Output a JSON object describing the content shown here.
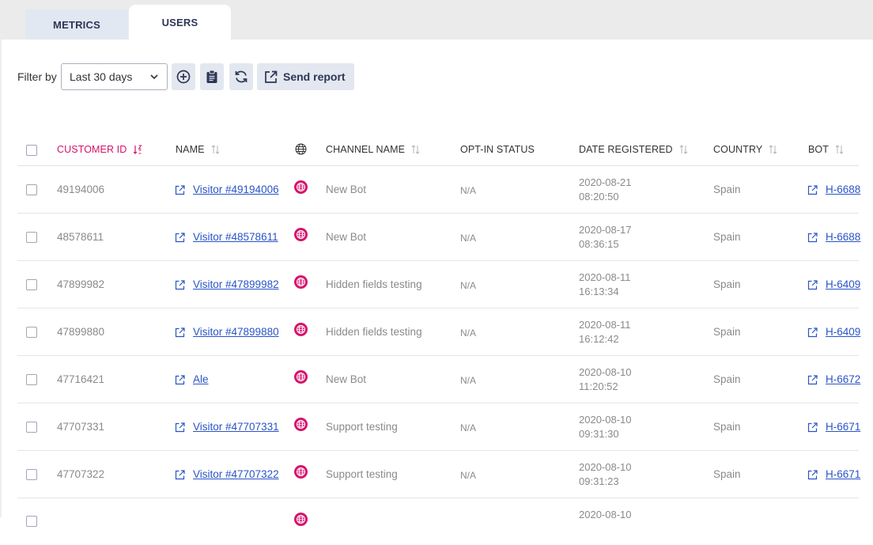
{
  "tabs": [
    {
      "label": "METRICS",
      "active": false
    },
    {
      "label": "USERS",
      "active": true
    }
  ],
  "toolbar": {
    "filter_label": "Filter by",
    "filter_value": "Last 30 days",
    "send_report_label": "Send report"
  },
  "table": {
    "headers": {
      "customer_id": "CUSTOMER ID",
      "name": "NAME",
      "channel_name": "CHANNEL NAME",
      "optin_status": "OPT-IN STATUS",
      "date_registered": "DATE REGISTERED",
      "country": "COUNTRY",
      "bot": "BOT"
    },
    "rows": [
      {
        "customer_id": "49194006",
        "name": "Visitor #49194006",
        "channel": "New Bot",
        "optin": "N/A",
        "date": "2020-08-21",
        "time": "08:20:50",
        "country": "Spain",
        "bot": "H-6688"
      },
      {
        "customer_id": "48578611",
        "name": "Visitor #48578611",
        "channel": "New Bot",
        "optin": "N/A",
        "date": "2020-08-17",
        "time": "08:36:15",
        "country": "Spain",
        "bot": "H-6688"
      },
      {
        "customer_id": "47899982",
        "name": "Visitor #47899982",
        "channel": "Hidden fields testing",
        "optin": "N/A",
        "date": "2020-08-11",
        "time": "16:13:34",
        "country": "Spain",
        "bot": "H-6409"
      },
      {
        "customer_id": "47899880",
        "name": "Visitor #47899880",
        "channel": "Hidden fields testing",
        "optin": "N/A",
        "date": "2020-08-11",
        "time": "16:12:42",
        "country": "Spain",
        "bot": "H-6409"
      },
      {
        "customer_id": "47716421",
        "name": "Ale",
        "channel": "New Bot",
        "optin": "N/A",
        "date": "2020-08-10",
        "time": "11:20:52",
        "country": "Spain",
        "bot": "H-6672"
      },
      {
        "customer_id": "47707331",
        "name": "Visitor #47707331",
        "channel": "Support testing",
        "optin": "N/A",
        "date": "2020-08-10",
        "time": "09:31:30",
        "country": "Spain",
        "bot": "H-6671"
      },
      {
        "customer_id": "47707322",
        "name": "Visitor #47707322",
        "channel": "Support testing",
        "optin": "N/A",
        "date": "2020-08-10",
        "time": "09:31:23",
        "country": "Spain",
        "bot": "H-6671"
      },
      {
        "customer_id": "",
        "name": "",
        "channel": "",
        "optin": "",
        "date": "2020-08-10",
        "time": "",
        "country": "",
        "bot": ""
      }
    ]
  },
  "colors": {
    "accent_pink": "#d6126b",
    "link_blue": "#2a54c6",
    "button_bg": "#e3e7ef",
    "dark_text": "#2d3656"
  },
  "icons": {
    "add": "plus-circle-icon",
    "clipboard": "clipboard-icon",
    "refresh": "refresh-icon",
    "send": "external-link-icon",
    "channel": "globe-icon",
    "sort": "sort-icon"
  }
}
